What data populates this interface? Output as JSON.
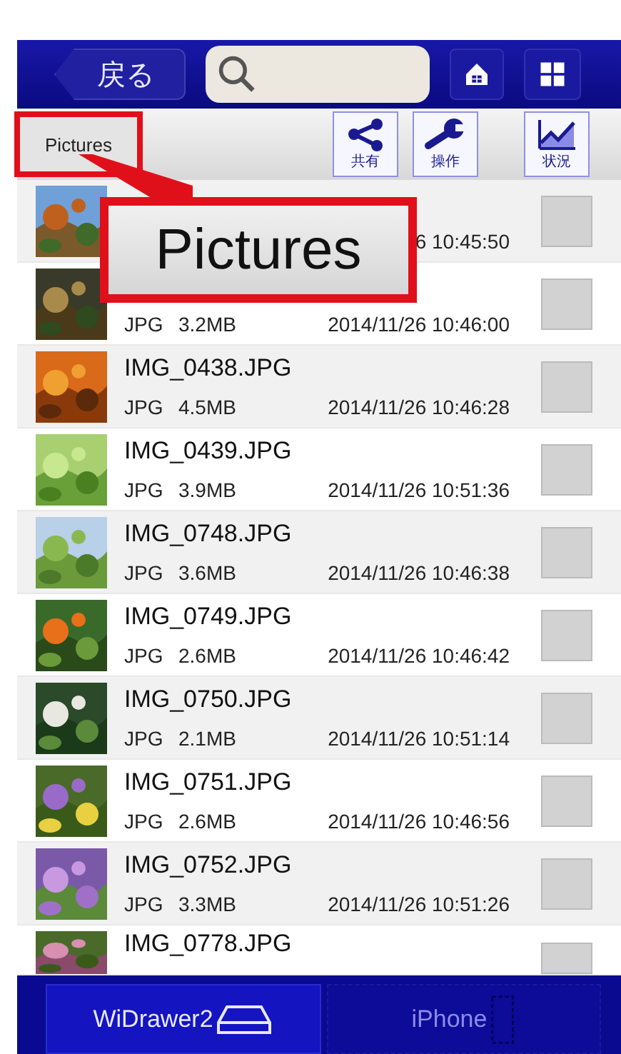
{
  "header": {
    "back_button": "戻る"
  },
  "toolbar": {
    "folder": "Pictures",
    "actions": [
      {
        "kind": "share",
        "label": "共有"
      },
      {
        "kind": "tool",
        "label": "操作"
      },
      {
        "kind": "chart",
        "label": "状況"
      }
    ]
  },
  "callout": "Pictures",
  "files": [
    {
      "date": "6 10:45:50",
      "checked": false
    },
    {
      "type": "JPG",
      "size": "3.2MB",
      "date": "2014/11/26 10:46:00",
      "checked": false
    },
    {
      "name": "IMG_0438.JPG",
      "type": "JPG",
      "size": "4.5MB",
      "date": "2014/11/26 10:46:28",
      "checked": false
    },
    {
      "name": "IMG_0439.JPG",
      "type": "JPG",
      "size": "3.9MB",
      "date": "2014/11/26 10:51:36",
      "checked": false
    },
    {
      "name": "IMG_0748.JPG",
      "type": "JPG",
      "size": "3.6MB",
      "date": "2014/11/26 10:46:38",
      "checked": false
    },
    {
      "name": "IMG_0749.JPG",
      "type": "JPG",
      "size": "2.6MB",
      "date": "2014/11/26 10:46:42",
      "checked": false
    },
    {
      "name": "IMG_0750.JPG",
      "type": "JPG",
      "size": "2.1MB",
      "date": "2014/11/26 10:51:14",
      "checked": false
    },
    {
      "name": "IMG_0751.JPG",
      "type": "JPG",
      "size": "2.6MB",
      "date": "2014/11/26 10:46:56",
      "checked": false
    },
    {
      "name": "IMG_0752.JPG",
      "type": "JPG",
      "size": "3.3MB",
      "date": "2014/11/26 10:51:26",
      "checked": false
    },
    {
      "name": "IMG_0778.JPG",
      "checked": false
    }
  ],
  "tabs": [
    {
      "kind": "drive",
      "label": "WiDrawer2",
      "selected": true
    },
    {
      "kind": "phone",
      "label": "iPhone",
      "selected": false
    }
  ]
}
